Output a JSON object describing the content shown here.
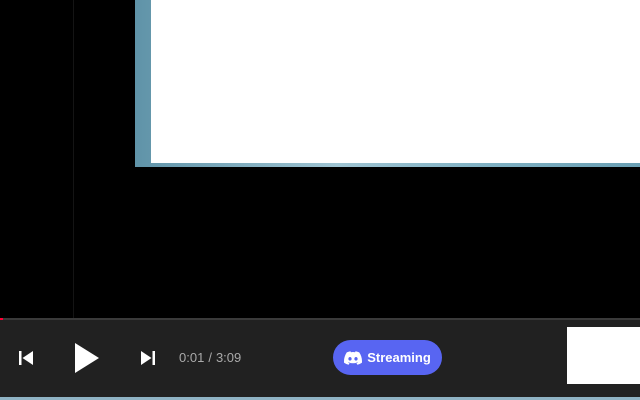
{
  "player": {
    "time_current": "0:01",
    "time_separator": "/",
    "time_total": "3:09",
    "progress_fraction": 0.005
  },
  "controls": {
    "previous_icon": "skip-previous-icon",
    "play_icon": "play-icon",
    "next_icon": "skip-next-icon"
  },
  "discord": {
    "label": "Streaming",
    "icon": "discord-icon",
    "color": "#5865f2"
  },
  "colors": {
    "bar_background": "#212121",
    "progress": "#ff0033",
    "time_text": "#aaaaaa"
  }
}
